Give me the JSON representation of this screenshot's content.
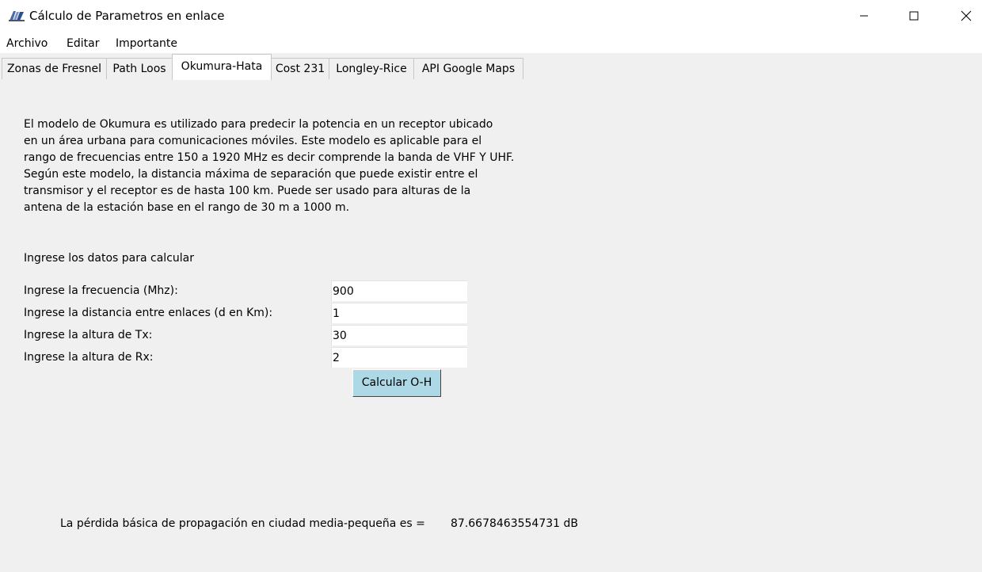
{
  "window": {
    "title": "Cálculo de Parametros en enlace",
    "icon": "tk-feather-icon",
    "controls": [
      "minimize-icon",
      "maximize-icon",
      "close-icon"
    ]
  },
  "menu": {
    "items": [
      "Archivo",
      "Editar",
      "Importante"
    ]
  },
  "tabs": {
    "items": [
      "Zonas de Fresnel",
      "Path Loos",
      "Okumura-Hata",
      "Cost 231",
      "Longley-Rice",
      "API Google Maps"
    ],
    "active": "Okumura-Hata"
  },
  "description": {
    "lines": [
      "El modelo de Okumura es utilizado para predecir la potencia en un receptor ubicado",
      "en un área urbana para comunicaciones móviles. Este modelo es aplicable para el",
      "rango de frecuencias entre 150 a 1920 MHz es decir comprende la banda de VHF Y UHF.",
      "Según este modelo, la distancia máxima de separación que puede existir entre el",
      "transmisor y el receptor es de hasta 100 km. Puede ser usado para alturas de la",
      "antena de la estación base en el rango de 30 m a 1000 m."
    ]
  },
  "form": {
    "prompt": "Ingrese los datos para calcular",
    "fields": [
      {
        "label": "Ingrese la frecuencia (Mhz):",
        "value": "900"
      },
      {
        "label": "Ingrese la distancia entre enlaces (d en Km):",
        "value": "1"
      },
      {
        "label": "Ingrese la altura de Tx:",
        "value": "30"
      },
      {
        "label": "Ingrese la altura de Rx:",
        "value": "2"
      }
    ],
    "button_label": "Calcular O-H"
  },
  "result": {
    "label": "La pérdida básica de propagación en ciudad media-pequeña es =",
    "value": "87.6678463554731 dB"
  },
  "colors": {
    "button_bg": "#add8e6",
    "window_bg": "#f0f0f0"
  }
}
